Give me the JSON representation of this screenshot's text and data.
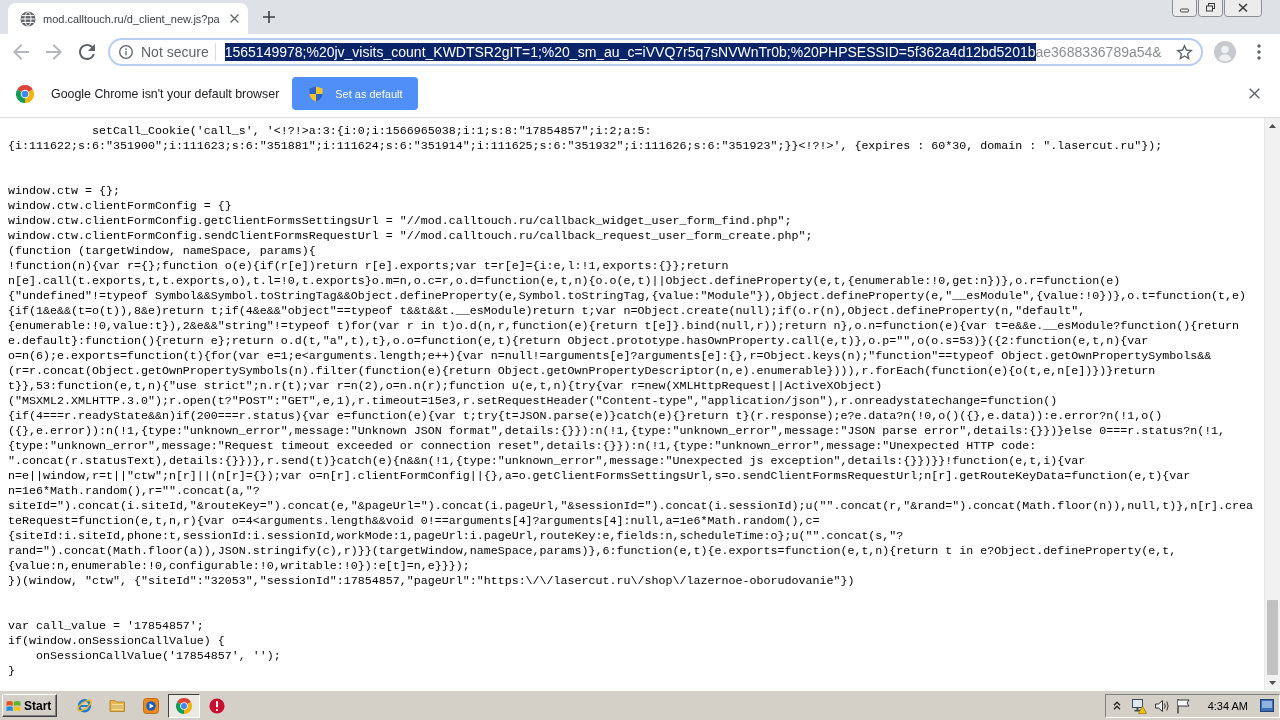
{
  "tabs": [
    {
      "title": "mod.calltouch.ru/d_client_new.js?pa",
      "selected": true
    }
  ],
  "toolbar": {
    "nav_buttons": [
      {
        "kind": "back",
        "disabled": true
      },
      {
        "kind": "forward",
        "disabled": true
      },
      {
        "kind": "reload",
        "disabled": false
      }
    ],
    "security_label": "Not secure",
    "url_segments": [
      {
        "text": "1565149978;%20jv_visits_count_KWDTSR2gIT=1;%20_sm_au_c=iVVQ7r5q7sNVWnTr0b;%20PHPSESSID=5f362a4d12bd5201b",
        "selected": true
      },
      {
        "text": "ae3688336789a54&",
        "selected": false
      }
    ]
  },
  "infobar": {
    "message": "Google Chrome isn't your default browser",
    "button": "Set as default"
  },
  "document": {
    "blocks": [
      {
        "lines": [
          "            setCall_Cookie('call_s', '<!?!>a:3:{i:0;i:1566965038;i:1;s:8:\"17854857\";i:2;a:5:",
          "{i:111622;s:6:\"351900\";i:111623;s:6:\"351881\";i:111624;s:6:\"351914\";i:111625;s:6:\"351932\";i:111626;s:6:\"351923\";}}<!?!>', {expires : 60*30, domain : \".lasercut.ru\"});"
        ]
      },
      {
        "lines": [
          "window.ctw = {};",
          "window.ctw.clientFormConfig = {}",
          "window.ctw.clientFormConfig.getClientFormsSettingsUrl = \"//mod.calltouch.ru/callback_widget_user_form_find.php\";",
          "window.ctw.clientFormConfig.sendClientFormsRequestUrl = \"//mod.calltouch.ru/callback_request_user_form_create.php\";",
          "(function (targetWindow, nameSpace, params){",
          "!function(n){var r={};function o(e){if(r[e])return r[e].exports;var t=r[e]={i:e,l:!1,exports:{}};return",
          "n[e].call(t.exports,t,t.exports,o),t.l=!0,t.exports}o.m=n,o.c=r,o.d=function(e,t,n){o.o(e,t)||Object.defineProperty(e,t,{enumerable:!0,get:n})},o.r=function(e)",
          "{\"undefined\"!=typeof Symbol&&Symbol.toStringTag&&Object.defineProperty(e,Symbol.toStringTag,{value:\"Module\"}),Object.defineProperty(e,\"__esModule\",{value:!0})},o.t=function(t,e)",
          "{if(1&e&&(t=o(t)),8&e)return t;if(4&e&&\"object\"==typeof t&&t&&t.__esModule)return t;var n=Object.create(null);if(o.r(n),Object.defineProperty(n,\"default\",",
          "{enumerable:!0,value:t}),2&e&&\"string\"!=typeof t)for(var r in t)o.d(n,r,function(e){return t[e]}.bind(null,r));return n},o.n=function(e){var t=e&&e.__esModule?function(){return",
          "e.default}:function(){return e};return o.d(t,\"a\",t),t},o.o=function(e,t){return Object.prototype.hasOwnProperty.call(e,t)},o.p=\"\",o(o.s=53)}({2:function(e,t,n){var",
          "o=n(6);e.exports=function(t){for(var e=1;e<arguments.length;e++){var n=null!=arguments[e]?arguments[e]:{},r=Object.keys(n);\"function\"==typeof Object.getOwnPropertySymbols&&",
          "(r=r.concat(Object.getOwnPropertySymbols(n).filter(function(e){return Object.getOwnPropertyDescriptor(n,e).enumerable}))),r.forEach(function(e){o(t,e,n[e])})}return",
          "t}},53:function(e,t,n){\"use strict\";n.r(t);var r=n(2),o=n.n(r);function u(e,t,n){try{var r=new(XMLHttpRequest||ActiveXObject)",
          "(\"MSXML2.XMLHTTP.3.0\");r.open(t?\"POST\":\"GET\",e,1),r.timeout=15e3,r.setRequestHeader(\"Content-type\",\"application/json\"),r.onreadystatechange=function()",
          "{if(4===r.readyState&&n)if(200===r.status){var e=function(e){var t;try{t=JSON.parse(e)}catch(e){}return t}(r.response);e?e.data?n(!0,o()({},e.data)):e.error?n(!1,o()",
          "({},e.error)):n(!1,{type:\"unknown_error\",message:\"Unknown JSON format\",details:{}}):n(!1,{type:\"unknown_error\",message:\"JSON parse error\",details:{}})}else 0===r.status?n(!1,",
          "{type:\"unknown_error\",message:\"Request timeout exceeded or connection reset\",details:{}}):n(!1,{type:\"unknown_error\",message:\"Unexpected HTTP code:",
          "\".concat(r.statusText),details:{}})},r.send(t)}catch(e){n&&n(!1,{type:\"unknown_error\",message:\"Unexpected js exception\",details:{}})}}!function(e,t,i){var",
          "n=e||window,r=t||\"ctw\";n[r]||(n[r]={});var o=n[r].clientFormConfig||{},a=o.getClientFormsSettingsUrl,s=o.sendClientFormsRequestUrl;n[r].getRouteKeyData=function(e,t){var",
          "n=1e6*Math.random(),r=\"\".concat(a,\"?",
          "siteId=\").concat(i.siteId,\"&routeKey=\").concat(e,\"&pageUrl=\").concat(i.pageUrl,\"&sessionId=\").concat(i.sessionId);u(\"\".concat(r,\"&rand=\").concat(Math.floor(n)),null,t)},n[r].crea",
          "teRequest=function(e,t,n,r){var o=4<arguments.length&&void 0!==arguments[4]?arguments[4]:null,a=1e6*Math.random(),c=",
          "{siteId:i.siteId,phone:t,sessionId:i.sessionId,workMode:1,pageUrl:i.pageUrl,routeKey:e,fields:n,scheduleTime:o};u(\"\".concat(s,\"?",
          "rand=\").concat(Math.floor(a)),JSON.stringify(c),r)}}(targetWindow,nameSpace,params)},6:function(e,t){e.exports=function(e,t,n){return t in e?Object.defineProperty(e,t,",
          "{value:n,enumerable:!0,configurable:!0,writable:!0}):e[t]=n,e}}});",
          "})(window, \"ctw\", {\"siteId\":\"32053\",\"sessionId\":17854857,\"pageUrl\":\"https:\\/\\/lasercut.ru\\/shop\\/lazernoe-oborudovanie\"})"
        ]
      },
      {
        "lines": [
          "var call_value = '17854857';",
          "if(window.onSessionCallValue) {",
          "    onSessionCallValue('17854857', '');",
          "}"
        ]
      }
    ]
  },
  "taskbar": {
    "start": "Start",
    "apps": [
      {
        "kind": "swoosh",
        "selected": false
      },
      {
        "kind": "folder",
        "selected": false
      },
      {
        "kind": "player",
        "selected": false
      },
      {
        "kind": "ring",
        "selected": true
      },
      {
        "kind": "alert",
        "selected": false
      }
    ],
    "clock": "4:34 AM"
  }
}
